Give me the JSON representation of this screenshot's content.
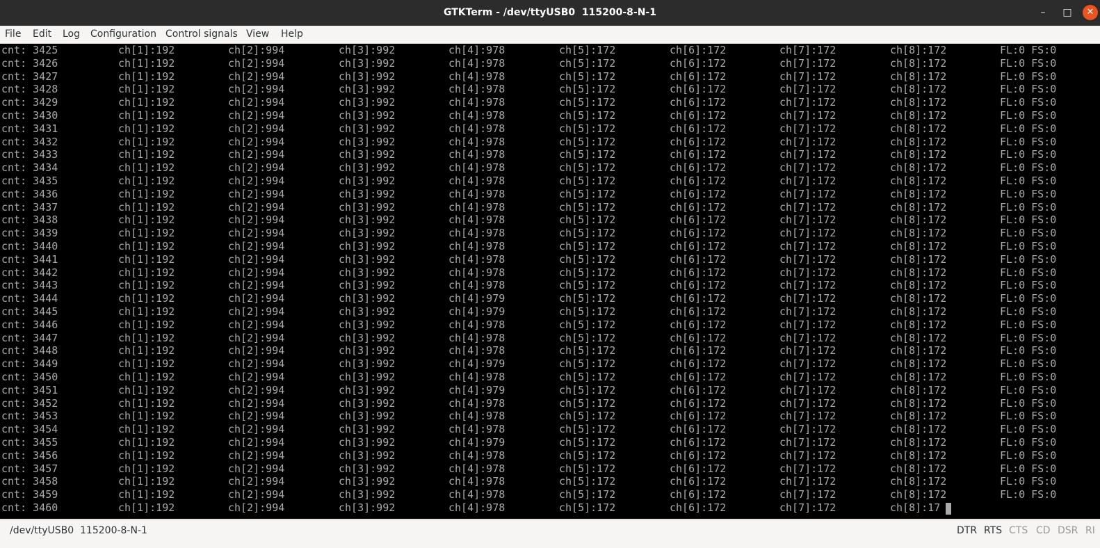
{
  "window": {
    "title": "GTKTerm - /dev/ttyUSB0  115200-8-N-1",
    "minimize_glyph": "–",
    "maximize_glyph": "□",
    "close_glyph": "✕"
  },
  "menu": [
    "File",
    "Edit",
    "Log",
    "Configuration",
    "Control signals",
    "View",
    "Help"
  ],
  "terminal": {
    "rows": [
      [
        "cnt: 3425",
        "ch[1]:192",
        "ch[2]:994",
        "ch[3]:992",
        "ch[4]:978",
        "ch[5]:172",
        "ch[6]:172",
        "ch[7]:172",
        "ch[8]:172",
        "FL:0 FS:0"
      ],
      [
        "cnt: 3426",
        "ch[1]:192",
        "ch[2]:994",
        "ch[3]:992",
        "ch[4]:978",
        "ch[5]:172",
        "ch[6]:172",
        "ch[7]:172",
        "ch[8]:172",
        "FL:0 FS:0"
      ],
      [
        "cnt: 3427",
        "ch[1]:192",
        "ch[2]:994",
        "ch[3]:992",
        "ch[4]:978",
        "ch[5]:172",
        "ch[6]:172",
        "ch[7]:172",
        "ch[8]:172",
        "FL:0 FS:0"
      ],
      [
        "cnt: 3428",
        "ch[1]:192",
        "ch[2]:994",
        "ch[3]:992",
        "ch[4]:978",
        "ch[5]:172",
        "ch[6]:172",
        "ch[7]:172",
        "ch[8]:172",
        "FL:0 FS:0"
      ],
      [
        "cnt: 3429",
        "ch[1]:192",
        "ch[2]:994",
        "ch[3]:992",
        "ch[4]:978",
        "ch[5]:172",
        "ch[6]:172",
        "ch[7]:172",
        "ch[8]:172",
        "FL:0 FS:0"
      ],
      [
        "cnt: 3430",
        "ch[1]:192",
        "ch[2]:994",
        "ch[3]:992",
        "ch[4]:978",
        "ch[5]:172",
        "ch[6]:172",
        "ch[7]:172",
        "ch[8]:172",
        "FL:0 FS:0"
      ],
      [
        "cnt: 3431",
        "ch[1]:192",
        "ch[2]:994",
        "ch[3]:992",
        "ch[4]:978",
        "ch[5]:172",
        "ch[6]:172",
        "ch[7]:172",
        "ch[8]:172",
        "FL:0 FS:0"
      ],
      [
        "cnt: 3432",
        "ch[1]:192",
        "ch[2]:994",
        "ch[3]:992",
        "ch[4]:978",
        "ch[5]:172",
        "ch[6]:172",
        "ch[7]:172",
        "ch[8]:172",
        "FL:0 FS:0"
      ],
      [
        "cnt: 3433",
        "ch[1]:192",
        "ch[2]:994",
        "ch[3]:992",
        "ch[4]:978",
        "ch[5]:172",
        "ch[6]:172",
        "ch[7]:172",
        "ch[8]:172",
        "FL:0 FS:0"
      ],
      [
        "cnt: 3434",
        "ch[1]:192",
        "ch[2]:994",
        "ch[3]:992",
        "ch[4]:978",
        "ch[5]:172",
        "ch[6]:172",
        "ch[7]:172",
        "ch[8]:172",
        "FL:0 FS:0"
      ],
      [
        "cnt: 3435",
        "ch[1]:192",
        "ch[2]:994",
        "ch[3]:992",
        "ch[4]:978",
        "ch[5]:172",
        "ch[6]:172",
        "ch[7]:172",
        "ch[8]:172",
        "FL:0 FS:0"
      ],
      [
        "cnt: 3436",
        "ch[1]:192",
        "ch[2]:994",
        "ch[3]:992",
        "ch[4]:978",
        "ch[5]:172",
        "ch[6]:172",
        "ch[7]:172",
        "ch[8]:172",
        "FL:0 FS:0"
      ],
      [
        "cnt: 3437",
        "ch[1]:192",
        "ch[2]:994",
        "ch[3]:992",
        "ch[4]:978",
        "ch[5]:172",
        "ch[6]:172",
        "ch[7]:172",
        "ch[8]:172",
        "FL:0 FS:0"
      ],
      [
        "cnt: 3438",
        "ch[1]:192",
        "ch[2]:994",
        "ch[3]:992",
        "ch[4]:978",
        "ch[5]:172",
        "ch[6]:172",
        "ch[7]:172",
        "ch[8]:172",
        "FL:0 FS:0"
      ],
      [
        "cnt: 3439",
        "ch[1]:192",
        "ch[2]:994",
        "ch[3]:992",
        "ch[4]:978",
        "ch[5]:172",
        "ch[6]:172",
        "ch[7]:172",
        "ch[8]:172",
        "FL:0 FS:0"
      ],
      [
        "cnt: 3440",
        "ch[1]:192",
        "ch[2]:994",
        "ch[3]:992",
        "ch[4]:978",
        "ch[5]:172",
        "ch[6]:172",
        "ch[7]:172",
        "ch[8]:172",
        "FL:0 FS:0"
      ],
      [
        "cnt: 3441",
        "ch[1]:192",
        "ch[2]:994",
        "ch[3]:992",
        "ch[4]:978",
        "ch[5]:172",
        "ch[6]:172",
        "ch[7]:172",
        "ch[8]:172",
        "FL:0 FS:0"
      ],
      [
        "cnt: 3442",
        "ch[1]:192",
        "ch[2]:994",
        "ch[3]:992",
        "ch[4]:978",
        "ch[5]:172",
        "ch[6]:172",
        "ch[7]:172",
        "ch[8]:172",
        "FL:0 FS:0"
      ],
      [
        "cnt: 3443",
        "ch[1]:192",
        "ch[2]:994",
        "ch[3]:992",
        "ch[4]:978",
        "ch[5]:172",
        "ch[6]:172",
        "ch[7]:172",
        "ch[8]:172",
        "FL:0 FS:0"
      ],
      [
        "cnt: 3444",
        "ch[1]:192",
        "ch[2]:994",
        "ch[3]:992",
        "ch[4]:979",
        "ch[5]:172",
        "ch[6]:172",
        "ch[7]:172",
        "ch[8]:172",
        "FL:0 FS:0"
      ],
      [
        "cnt: 3445",
        "ch[1]:192",
        "ch[2]:994",
        "ch[3]:992",
        "ch[4]:979",
        "ch[5]:172",
        "ch[6]:172",
        "ch[7]:172",
        "ch[8]:172",
        "FL:0 FS:0"
      ],
      [
        "cnt: 3446",
        "ch[1]:192",
        "ch[2]:994",
        "ch[3]:992",
        "ch[4]:978",
        "ch[5]:172",
        "ch[6]:172",
        "ch[7]:172",
        "ch[8]:172",
        "FL:0 FS:0"
      ],
      [
        "cnt: 3447",
        "ch[1]:192",
        "ch[2]:994",
        "ch[3]:992",
        "ch[4]:978",
        "ch[5]:172",
        "ch[6]:172",
        "ch[7]:172",
        "ch[8]:172",
        "FL:0 FS:0"
      ],
      [
        "cnt: 3448",
        "ch[1]:192",
        "ch[2]:994",
        "ch[3]:992",
        "ch[4]:978",
        "ch[5]:172",
        "ch[6]:172",
        "ch[7]:172",
        "ch[8]:172",
        "FL:0 FS:0"
      ],
      [
        "cnt: 3449",
        "ch[1]:192",
        "ch[2]:994",
        "ch[3]:992",
        "ch[4]:979",
        "ch[5]:172",
        "ch[6]:172",
        "ch[7]:172",
        "ch[8]:172",
        "FL:0 FS:0"
      ],
      [
        "cnt: 3450",
        "ch[1]:192",
        "ch[2]:994",
        "ch[3]:992",
        "ch[4]:978",
        "ch[5]:172",
        "ch[6]:172",
        "ch[7]:172",
        "ch[8]:172",
        "FL:0 FS:0"
      ],
      [
        "cnt: 3451",
        "ch[1]:192",
        "ch[2]:994",
        "ch[3]:992",
        "ch[4]:979",
        "ch[5]:172",
        "ch[6]:172",
        "ch[7]:172",
        "ch[8]:172",
        "FL:0 FS:0"
      ],
      [
        "cnt: 3452",
        "ch[1]:192",
        "ch[2]:994",
        "ch[3]:992",
        "ch[4]:978",
        "ch[5]:172",
        "ch[6]:172",
        "ch[7]:172",
        "ch[8]:172",
        "FL:0 FS:0"
      ],
      [
        "cnt: 3453",
        "ch[1]:192",
        "ch[2]:994",
        "ch[3]:992",
        "ch[4]:978",
        "ch[5]:172",
        "ch[6]:172",
        "ch[7]:172",
        "ch[8]:172",
        "FL:0 FS:0"
      ],
      [
        "cnt: 3454",
        "ch[1]:192",
        "ch[2]:994",
        "ch[3]:992",
        "ch[4]:978",
        "ch[5]:172",
        "ch[6]:172",
        "ch[7]:172",
        "ch[8]:172",
        "FL:0 FS:0"
      ],
      [
        "cnt: 3455",
        "ch[1]:192",
        "ch[2]:994",
        "ch[3]:992",
        "ch[4]:979",
        "ch[5]:172",
        "ch[6]:172",
        "ch[7]:172",
        "ch[8]:172",
        "FL:0 FS:0"
      ],
      [
        "cnt: 3456",
        "ch[1]:192",
        "ch[2]:994",
        "ch[3]:992",
        "ch[4]:978",
        "ch[5]:172",
        "ch[6]:172",
        "ch[7]:172",
        "ch[8]:172",
        "FL:0 FS:0"
      ],
      [
        "cnt: 3457",
        "ch[1]:192",
        "ch[2]:994",
        "ch[3]:992",
        "ch[4]:978",
        "ch[5]:172",
        "ch[6]:172",
        "ch[7]:172",
        "ch[8]:172",
        "FL:0 FS:0"
      ],
      [
        "cnt: 3458",
        "ch[1]:192",
        "ch[2]:994",
        "ch[3]:992",
        "ch[4]:978",
        "ch[5]:172",
        "ch[6]:172",
        "ch[7]:172",
        "ch[8]:172",
        "FL:0 FS:0"
      ],
      [
        "cnt: 3459",
        "ch[1]:192",
        "ch[2]:994",
        "ch[3]:992",
        "ch[4]:978",
        "ch[5]:172",
        "ch[6]:172",
        "ch[7]:172",
        "ch[8]:172",
        "FL:0 FS:0"
      ],
      [
        "cnt: 3460",
        "ch[1]:192",
        "ch[2]:994",
        "ch[3]:992",
        "ch[4]:978",
        "ch[5]:172",
        "ch[6]:172",
        "ch[7]:172",
        "ch[8]:17"
      ]
    ],
    "text_color": "#aaaaaa",
    "background": "#000000"
  },
  "statusbar": {
    "port": "/dev/ttyUSB0  115200-8-N-1",
    "signals": [
      {
        "label": "DTR",
        "active": true
      },
      {
        "label": "RTS",
        "active": true
      },
      {
        "label": "CTS",
        "active": false
      },
      {
        "label": "CD",
        "active": false
      },
      {
        "label": "DSR",
        "active": false
      },
      {
        "label": "RI",
        "active": false
      }
    ]
  },
  "colors": {
    "titlebar": "#2c2c2c",
    "close_button": "#e95420",
    "chrome": "#f6f5f4"
  }
}
